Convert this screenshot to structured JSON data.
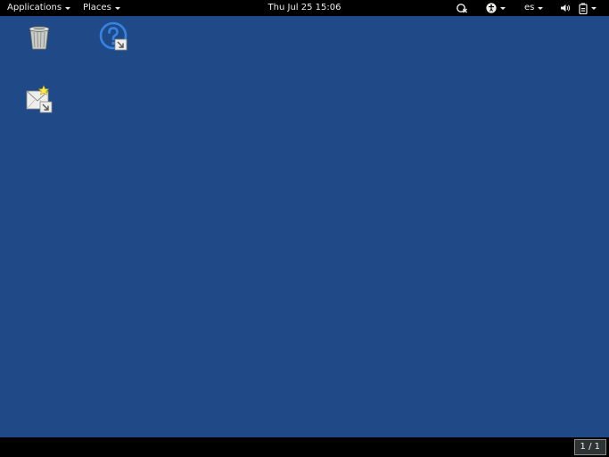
{
  "topbar": {
    "applications_label": "Applications",
    "places_label": "Places",
    "clock": "Thu Jul 25  15:06",
    "language": "es"
  },
  "tray_icons": [
    "accessibility-update-icon",
    "accessibility-icon",
    "volume-icon",
    "battery-icon"
  ],
  "desktop": {
    "background_color": "#204a87",
    "icons": [
      "trash-icon",
      "help-shortcut-icon",
      "mail-shortcut-icon"
    ]
  },
  "bottombar": {
    "workspace": "1 / 1"
  }
}
